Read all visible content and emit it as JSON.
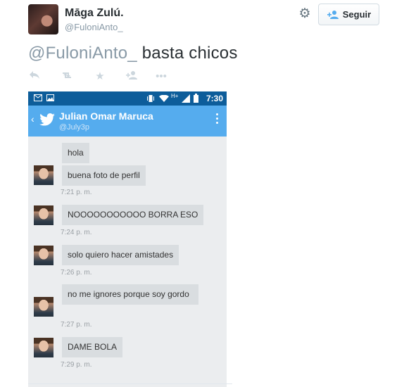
{
  "tweet": {
    "author_name": "Māga Zulú.",
    "author_handle": "@FuloniAnto_",
    "follow_label": "Seguir",
    "mention": "@FuloniAnto_",
    "text": " basta chicos"
  },
  "actions": {
    "icons": [
      "reply-icon",
      "retweet-icon",
      "favorite-icon",
      "follow-icon",
      "more-icon"
    ]
  },
  "screenshot": {
    "status_time": "7:30",
    "conversation_name": "Julian Omar Maruca",
    "conversation_handle": "@July3p",
    "accent_color": "#55acee",
    "statusbar_color": "#0d5d9a",
    "messages": [
      {
        "text": "hola",
        "time": ""
      },
      {
        "text": "buena foto de perfil",
        "time": "7:21 p. m."
      },
      {
        "text": "NOOOOOOOOOOO BORRA ESO",
        "time": "7:24 p. m."
      },
      {
        "text": "solo quiero hacer amistades",
        "time": "7:26 p. m."
      },
      {
        "text": "no me ignores porque soy gordo",
        "time": "7:27 p. m."
      },
      {
        "text": "DAME BOLA",
        "time": "7:29 p. m."
      }
    ]
  }
}
